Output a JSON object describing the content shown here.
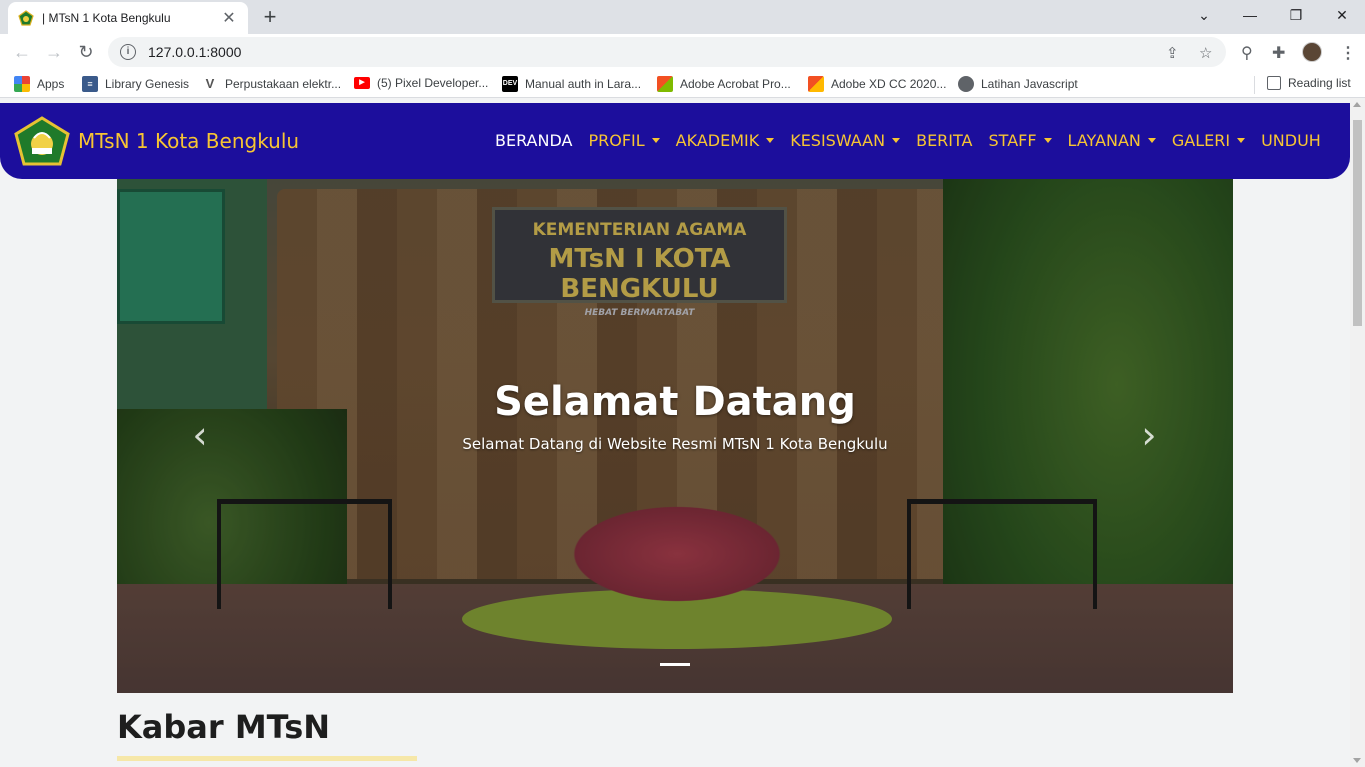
{
  "browser": {
    "tab_title": "| MTsN 1 Kota Bengkulu",
    "tab_close": "✕",
    "new_tab": "+",
    "window_controls": {
      "chevron": "⌄",
      "minimize": "—",
      "restore": "❐",
      "close": "✕"
    },
    "url": "127.0.0.1:8000",
    "nav_icons": {
      "back": "←",
      "forward": "→",
      "reload": "↻"
    },
    "bookmarks": [
      {
        "label": "Apps",
        "icon": "apps-grid-icon",
        "color": "#ea4335"
      },
      {
        "label": "Library Genesis",
        "icon": "library-icon",
        "color": "#3a5a8a"
      },
      {
        "label": "Perpustakaan elektr...",
        "icon": "v-icon",
        "color": "#555555"
      },
      {
        "label": "(5) Pixel Developer...",
        "icon": "youtube-icon",
        "color": "#ff0000"
      },
      {
        "label": "Manual auth in Lara...",
        "icon": "dev-icon",
        "color": "#000000"
      },
      {
        "label": "Adobe Acrobat Pro...",
        "icon": "windows-icon",
        "color": "#f25022"
      },
      {
        "label": "Adobe XD CC 2020...",
        "icon": "windows-icon",
        "color": "#f25022"
      },
      {
        "label": "Latihan Javascript",
        "icon": "globe-icon",
        "color": "#5f6368"
      }
    ],
    "reading_list": "Reading list"
  },
  "site": {
    "brand": "MTsN 1 Kota Bengkulu",
    "nav": [
      {
        "label": "BERANDA",
        "dropdown": false,
        "active": true
      },
      {
        "label": "PROFIL",
        "dropdown": true,
        "active": false
      },
      {
        "label": "AKADEMIK",
        "dropdown": true,
        "active": false
      },
      {
        "label": "KESISWAAN",
        "dropdown": true,
        "active": false
      },
      {
        "label": "BERITA",
        "dropdown": false,
        "active": false
      },
      {
        "label": "STAFF",
        "dropdown": true,
        "active": false
      },
      {
        "label": "LAYANAN",
        "dropdown": true,
        "active": false
      },
      {
        "label": "GALERI",
        "dropdown": true,
        "active": false
      },
      {
        "label": "UNDUH",
        "dropdown": false,
        "active": false
      }
    ],
    "carousel": {
      "sign_line1": "KEMENTERIAN AGAMA",
      "sign_line2": "MTsN I KOTA BENGKULU",
      "sign_line3": "HEBAT BERMARTABAT",
      "caption_title": "Selamat Datang",
      "caption_text": "Selamat Datang di Website Resmi MTsN 1 Kota Bengkulu",
      "prev": "‹",
      "next": "›"
    },
    "section_title": "Kabar MTsN"
  },
  "colors": {
    "nav_bg": "#1c0e9c",
    "nav_text": "#f7c533",
    "page_bg": "#f2f3f4",
    "underline": "#f6e7a8"
  }
}
